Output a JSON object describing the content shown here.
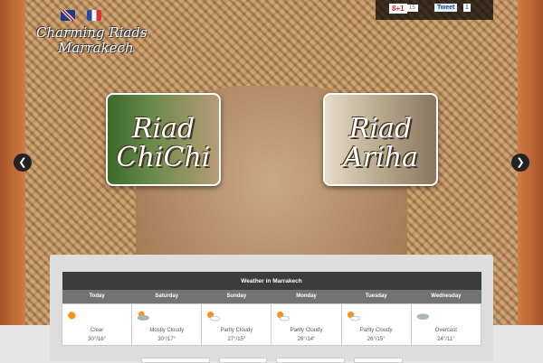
{
  "header": {
    "logo_line1": "Charming Riads",
    "logo_line2": "Marrakech",
    "gplus_label": "8+1",
    "gplus_count": "15",
    "tweet_label": "Tweet",
    "tweet_count": "1"
  },
  "slider": {
    "panels": [
      {
        "line1": "Riad",
        "line2": "ChiChi"
      },
      {
        "line1": "Riad",
        "line2": "Ariha"
      }
    ],
    "prev": "❮",
    "next": "❯"
  },
  "weather": {
    "title": "Weather in Marrakech",
    "days": [
      {
        "day": "Today",
        "icon": "sun",
        "condition": "Clear",
        "temp": "30°/16°"
      },
      {
        "day": "Saturday",
        "icon": "mostly-cloudy",
        "condition": "Mostly Cloudy",
        "temp": "30°/17°"
      },
      {
        "day": "Sunday",
        "icon": "partly-cloudy",
        "condition": "Partly Cloudy",
        "temp": "27°/15°"
      },
      {
        "day": "Monday",
        "icon": "partly-cloudy",
        "condition": "Partly Cloudy",
        "temp": "26°/14°"
      },
      {
        "day": "Tuesday",
        "icon": "partly-cloudy",
        "condition": "Partly Cloudy",
        "temp": "26°/15°"
      },
      {
        "day": "Wednesday",
        "icon": "overcast",
        "condition": "Overcast",
        "temp": "24°/11°"
      }
    ]
  }
}
